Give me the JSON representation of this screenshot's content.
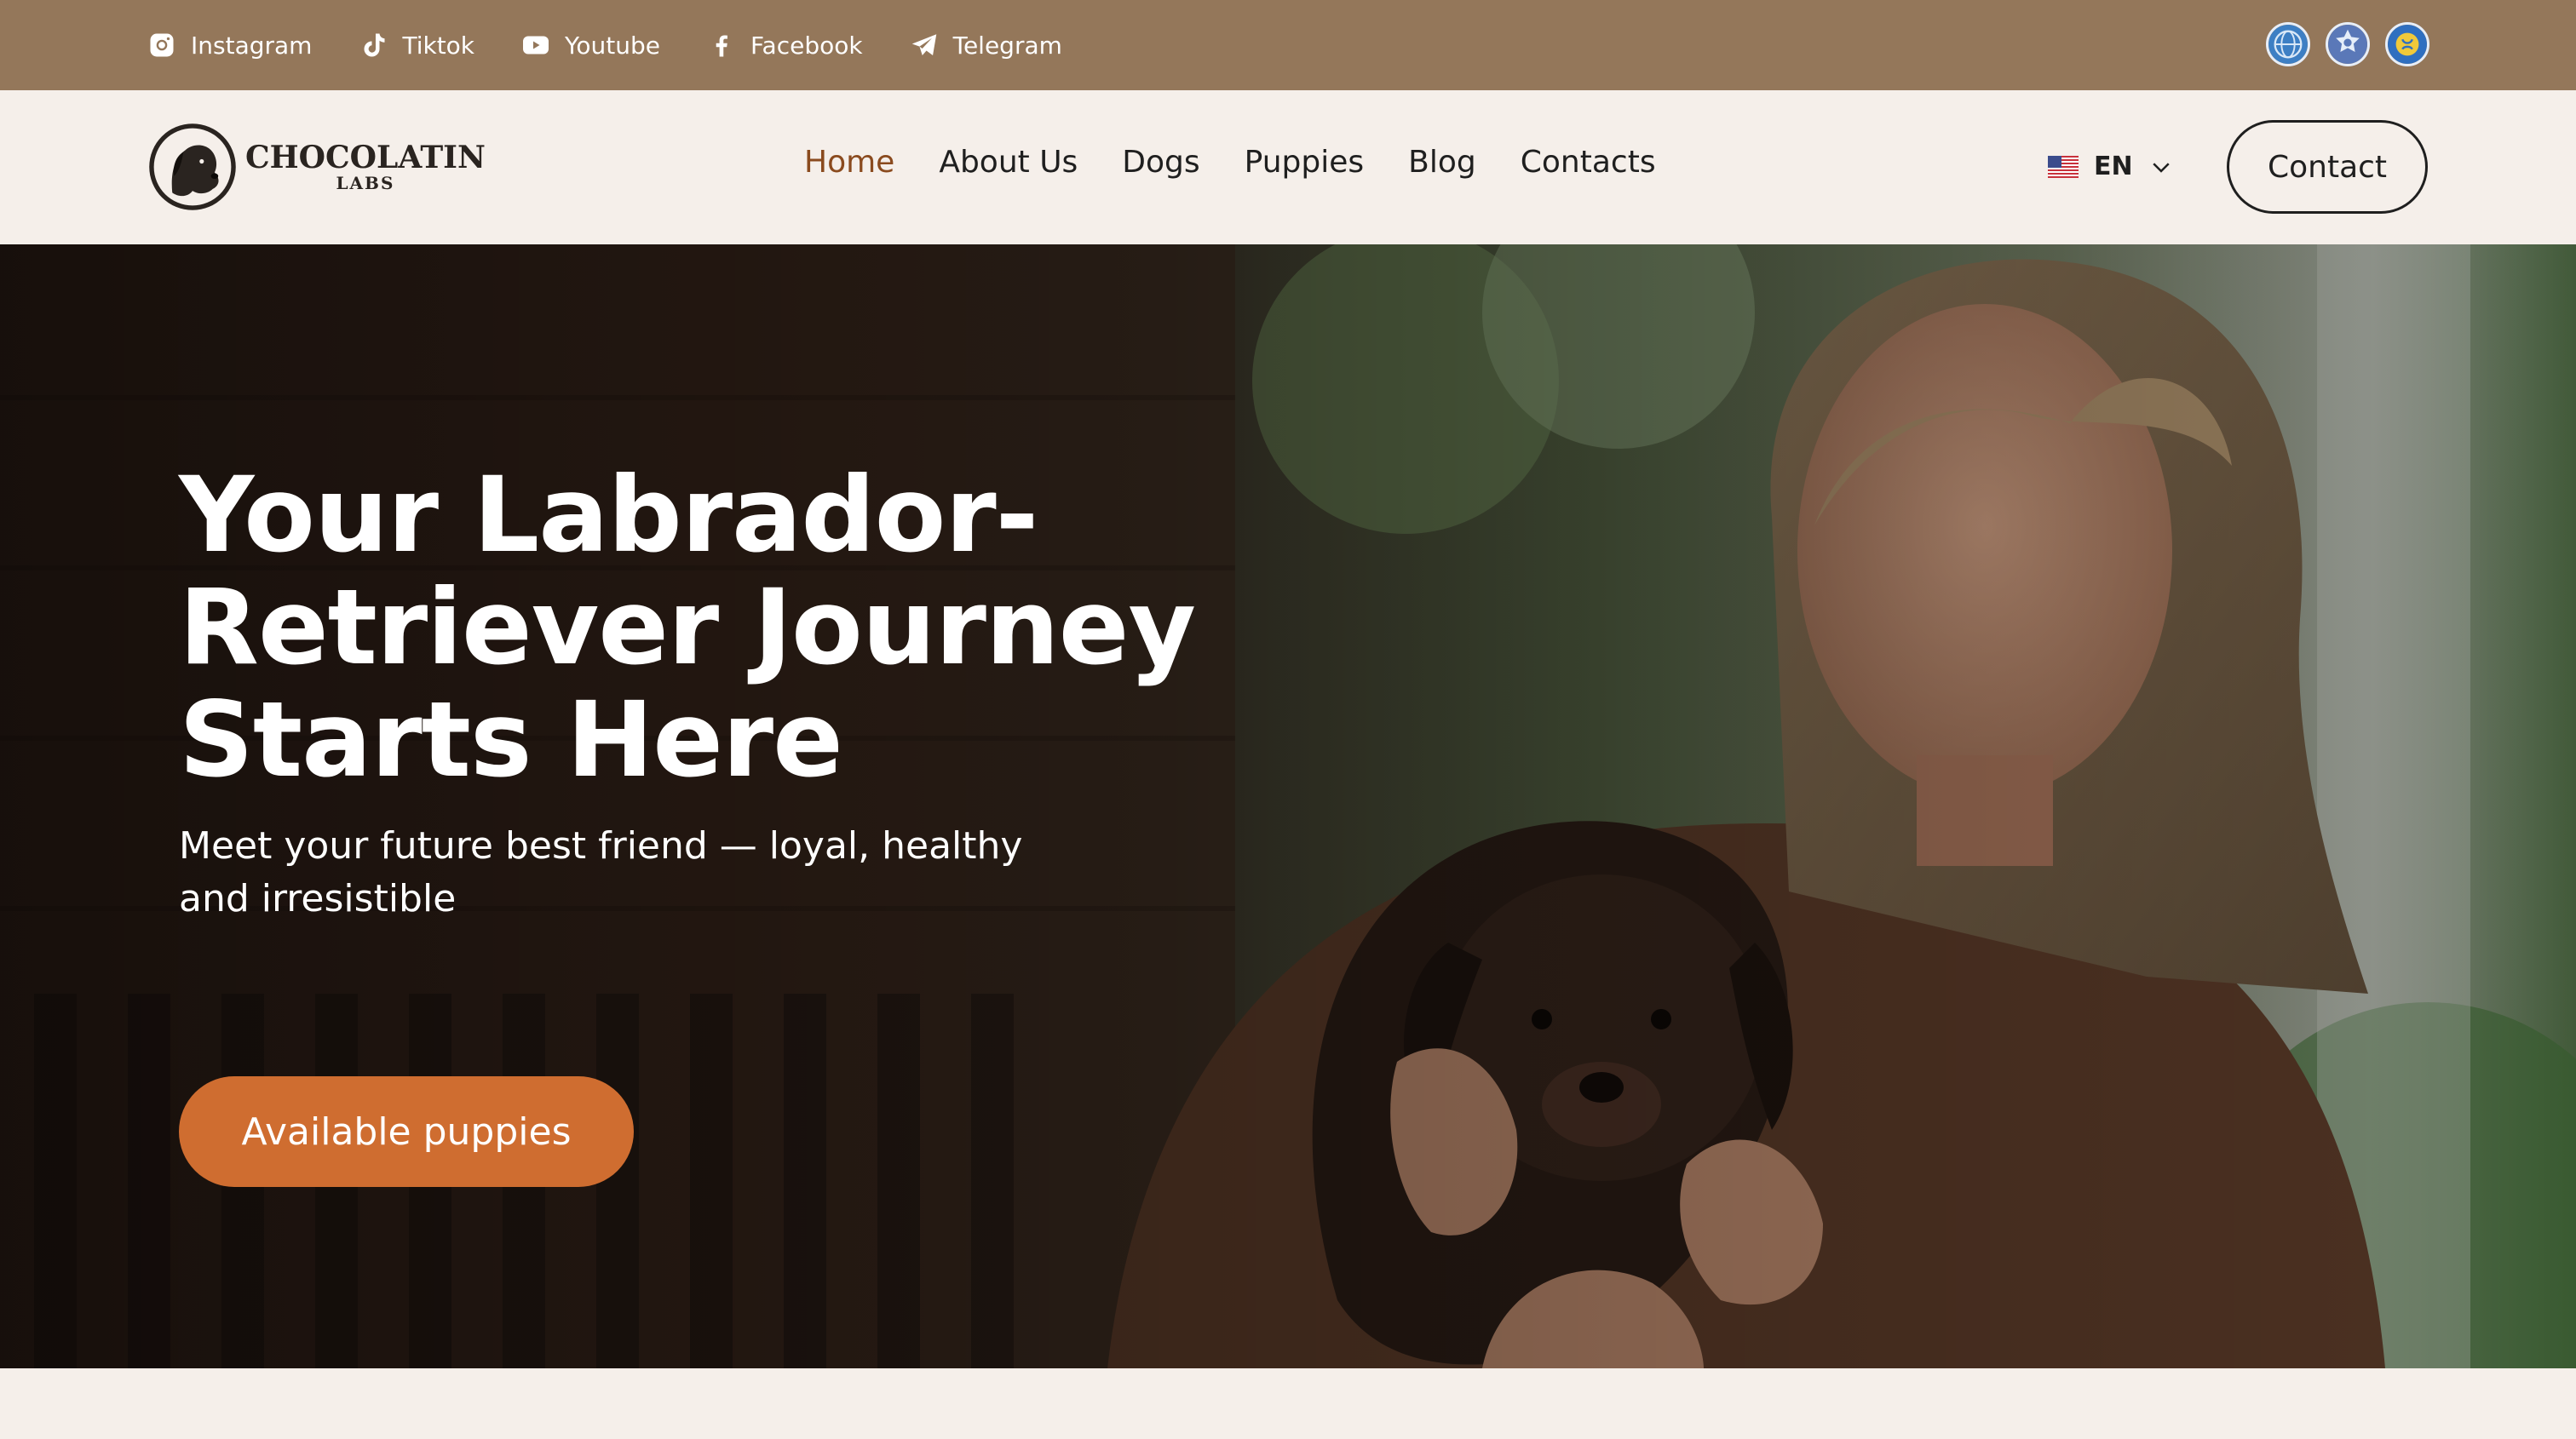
{
  "topbar": {
    "background": "#94775a",
    "social": [
      {
        "label": "Instagram",
        "icon": "instagram-icon"
      },
      {
        "label": "Tiktok",
        "icon": "tiktok-icon"
      },
      {
        "label": "Youtube",
        "icon": "youtube-icon"
      },
      {
        "label": "Facebook",
        "icon": "facebook-icon"
      },
      {
        "label": "Telegram",
        "icon": "telegram-icon"
      }
    ],
    "badges": [
      "fci-badge-icon",
      "kennel-club-badge-icon",
      "national-kennel-badge-icon"
    ]
  },
  "navbar": {
    "logo": {
      "title": "CHOCOLATIN",
      "subtitle": "LABS",
      "icon": "labrador-head-icon"
    },
    "menu": [
      {
        "label": "Home",
        "active": true
      },
      {
        "label": "About Us",
        "active": false
      },
      {
        "label": "Dogs",
        "active": false
      },
      {
        "label": "Puppies",
        "active": false
      },
      {
        "label": "Blog",
        "active": false
      },
      {
        "label": "Contacts",
        "active": false
      }
    ],
    "language": {
      "code": "EN",
      "flag": "us-flag-icon"
    },
    "contact_label": "Contact",
    "active_color": "#8a4a1e"
  },
  "hero": {
    "title_lines": [
      "Your Labrador-",
      "Retriever Journey",
      "Starts Here"
    ],
    "subtitle": "Meet your future best friend — loyal, healthy and irresistible",
    "cta_label": "Available puppies",
    "cta_color": "#cf6d30"
  }
}
